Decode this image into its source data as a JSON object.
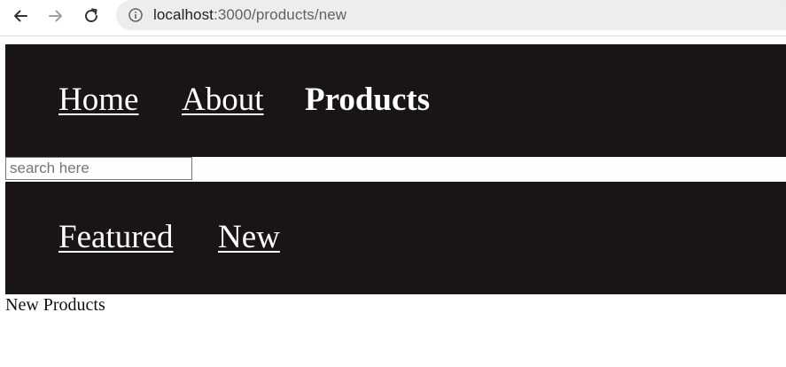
{
  "browser": {
    "url_host": "localhost",
    "url_path": ":3000/products/new"
  },
  "top_nav": {
    "items": [
      {
        "label": "Home"
      },
      {
        "label": "About"
      },
      {
        "label": "Products"
      }
    ]
  },
  "search": {
    "placeholder": "search here",
    "value": ""
  },
  "sub_nav": {
    "items": [
      {
        "label": "Featured"
      },
      {
        "label": "New"
      }
    ]
  },
  "main": {
    "text": "New Products"
  },
  "colors": {
    "nav_background": "#191515",
    "nav_text": "#ffffff",
    "page_background": "#ffffff"
  }
}
